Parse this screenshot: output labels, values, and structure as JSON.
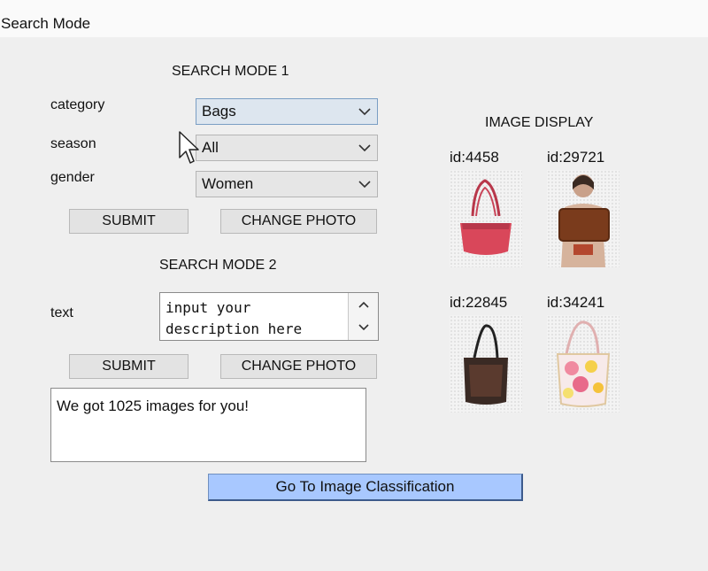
{
  "window": {
    "title": "Search Mode"
  },
  "mode1": {
    "heading": "SEARCH MODE 1",
    "category": {
      "label": "category",
      "value": "Bags"
    },
    "season": {
      "label": "season",
      "value": "All"
    },
    "gender": {
      "label": "gender",
      "value": "Women"
    },
    "submit_label": "SUBMIT",
    "change_photo_label": "CHANGE PHOTO"
  },
  "mode2": {
    "heading": "SEARCH MODE 2",
    "text_label": "text",
    "text_value": "input your\ndescription here",
    "submit_label": "SUBMIT",
    "change_photo_label": "CHANGE PHOTO"
  },
  "result": {
    "message": "We got 1025 images for you!"
  },
  "classification_button": "Go To Image Classification",
  "image_display": {
    "heading": "IMAGE DISPLAY",
    "images": [
      {
        "id": "id:4458",
        "color": "#d9475a"
      },
      {
        "id": "id:29721",
        "color": "#7a3b1c"
      },
      {
        "id": "id:22845",
        "color": "#3a2a24"
      },
      {
        "id": "id:34241",
        "color": "#f0c8c8"
      }
    ]
  }
}
